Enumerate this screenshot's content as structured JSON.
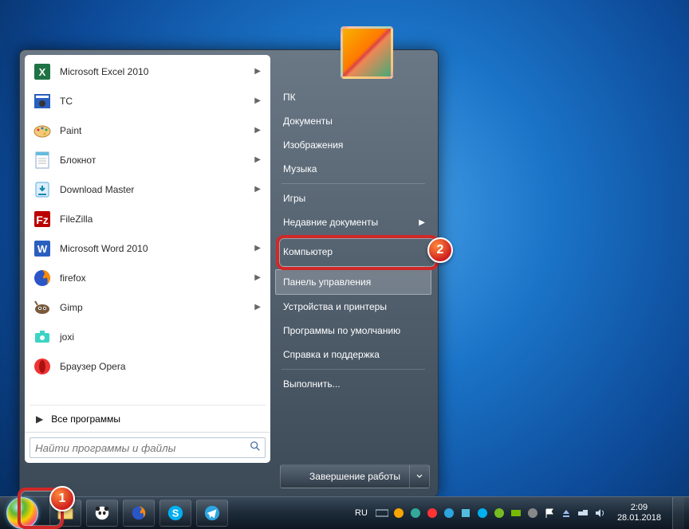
{
  "programs": [
    {
      "label": "Microsoft Excel 2010",
      "icon": "excel",
      "fly": true
    },
    {
      "label": "TC",
      "icon": "tc",
      "fly": true
    },
    {
      "label": "Paint",
      "icon": "paint",
      "fly": true
    },
    {
      "label": "Блокнот",
      "icon": "notepad",
      "fly": true
    },
    {
      "label": "Download Master",
      "icon": "dm",
      "fly": true
    },
    {
      "label": "FileZilla",
      "icon": "filezilla",
      "fly": false
    },
    {
      "label": "Microsoft Word 2010",
      "icon": "word",
      "fly": true
    },
    {
      "label": "firefox",
      "icon": "firefox",
      "fly": true
    },
    {
      "label": "Gimp",
      "icon": "gimp",
      "fly": true
    },
    {
      "label": "joxi",
      "icon": "joxi",
      "fly": false
    },
    {
      "label": "Браузер Opera",
      "icon": "opera",
      "fly": false
    }
  ],
  "all_programs_label": "Все программы",
  "search_placeholder": "Найти программы и файлы",
  "right_items": [
    {
      "label": "ПК",
      "sep": false,
      "fly": false
    },
    {
      "label": "Документы",
      "sep": false,
      "fly": false
    },
    {
      "label": "Изображения",
      "sep": false,
      "fly": false
    },
    {
      "label": "Музыка",
      "sep": false,
      "fly": false
    },
    {
      "label": "Игры",
      "sep": true,
      "fly": false
    },
    {
      "label": "Недавние документы",
      "sep": false,
      "fly": true
    },
    {
      "label": "Компьютер",
      "sep": true,
      "fly": false
    },
    {
      "label": "Панель управления",
      "sep": true,
      "fly": false,
      "hl": true
    },
    {
      "label": "Устройства и принтеры",
      "sep": false,
      "fly": false
    },
    {
      "label": "Программы по умолчанию",
      "sep": false,
      "fly": false
    },
    {
      "label": "Справка и поддержка",
      "sep": false,
      "fly": false
    },
    {
      "label": "Выполнить...",
      "sep": true,
      "fly": false
    }
  ],
  "shutdown_label": "Завершение работы",
  "lang": "RU",
  "time": "2:09",
  "date": "28.01.2018",
  "callouts": {
    "1": "1",
    "2": "2"
  }
}
